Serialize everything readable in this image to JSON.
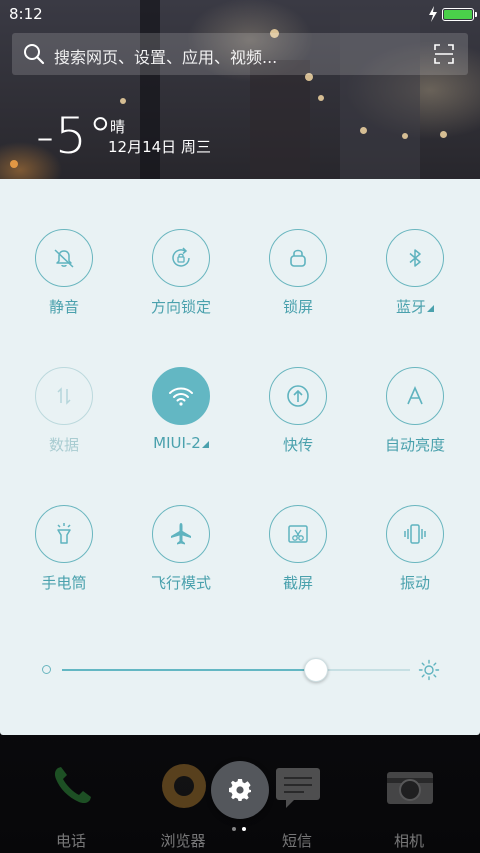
{
  "status_bar": {
    "time": "8:12",
    "battery_level": 1.0
  },
  "search": {
    "placeholder": "搜索网页、设置、应用、视频..."
  },
  "weather": {
    "temperature": "-5°",
    "condition": "晴",
    "date": "12月14日 周三"
  },
  "toggles": [
    {
      "label": "静音",
      "icon": "mute-icon",
      "state": "off"
    },
    {
      "label": "方向锁定",
      "icon": "rotation-lock-icon",
      "state": "off"
    },
    {
      "label": "锁屏",
      "icon": "lock-icon",
      "state": "off"
    },
    {
      "label": "蓝牙",
      "icon": "bluetooth-icon",
      "state": "off",
      "has_menu": true
    },
    {
      "label": "数据",
      "icon": "mobile-data-icon",
      "state": "disabled"
    },
    {
      "label": "MIUI-2",
      "icon": "wifi-icon",
      "state": "on",
      "has_menu": true
    },
    {
      "label": "快传",
      "icon": "quick-share-icon",
      "state": "off"
    },
    {
      "label": "自动亮度",
      "icon": "auto-brightness-icon",
      "state": "off"
    },
    {
      "label": "手电筒",
      "icon": "flashlight-icon",
      "state": "off"
    },
    {
      "label": "飞行模式",
      "icon": "airplane-icon",
      "state": "off"
    },
    {
      "label": "截屏",
      "icon": "screenshot-icon",
      "state": "off"
    },
    {
      "label": "振动",
      "icon": "vibrate-icon",
      "state": "off"
    }
  ],
  "brightness": {
    "level": 0.73
  },
  "dock": [
    {
      "label": "电话",
      "icon": "phone-icon"
    },
    {
      "label": "浏览器",
      "icon": "browser-icon"
    },
    {
      "label": "短信",
      "icon": "messages-icon"
    },
    {
      "label": "相机",
      "icon": "camera-icon"
    }
  ],
  "colors": {
    "accent": "#63b7c3",
    "panel_bg": "#e9f2f4",
    "label": "#4aa1ad",
    "disabled": "#a9ccd1"
  }
}
